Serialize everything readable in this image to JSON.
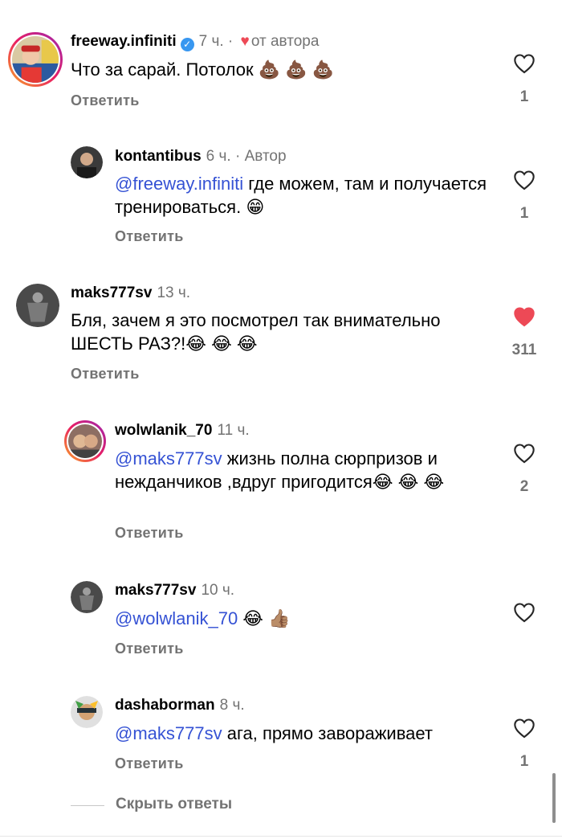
{
  "comments": [
    {
      "username": "freeway.infiniti",
      "time": "7 ч.",
      "author_like_label": "от автора",
      "text": "Что за сарай. Потолок 💩 💩 💩",
      "reply_label": "Ответить",
      "likes": "1",
      "liked": false
    },
    {
      "username": "kontantibus",
      "time": "6 ч.",
      "author_label": "· Автор",
      "mention": "@freeway.infiniti",
      "text": " где можем, там и получается тренироваться. 😁",
      "reply_label": "Ответить",
      "likes": "1",
      "liked": false
    },
    {
      "username": "maks777sv",
      "time": "13 ч.",
      "text": "Бля, зачем я это посмотрел так внимательно ШЕСТЬ РАЗ?!😂 😂 😂",
      "reply_label": "Ответить",
      "likes": "311",
      "liked": true
    },
    {
      "username": "wolwlanik_70",
      "time": "11 ч.",
      "mention": "@maks777sv",
      "text": " жизнь полна сюрпризов и нежданчиков ,вдруг пригодится😂 😂 😂",
      "reply_label": "Ответить",
      "likes": "2",
      "liked": false
    },
    {
      "username": "maks777sv",
      "time": "10 ч.",
      "mention": "@wolwlanik_70",
      "text": " 😂 👍🏽",
      "reply_label": "Ответить",
      "likes": "",
      "liked": false
    },
    {
      "username": "dashaborman",
      "time": "8 ч.",
      "mention": "@maks777sv",
      "text": " ага, прямо завораживает",
      "reply_label": "Ответить",
      "likes": "1",
      "liked": false
    }
  ],
  "hide_replies_label": "Скрыть ответы",
  "colors": {
    "mention": "#3552d4",
    "like_active": "#ed4956",
    "muted": "#737373"
  }
}
